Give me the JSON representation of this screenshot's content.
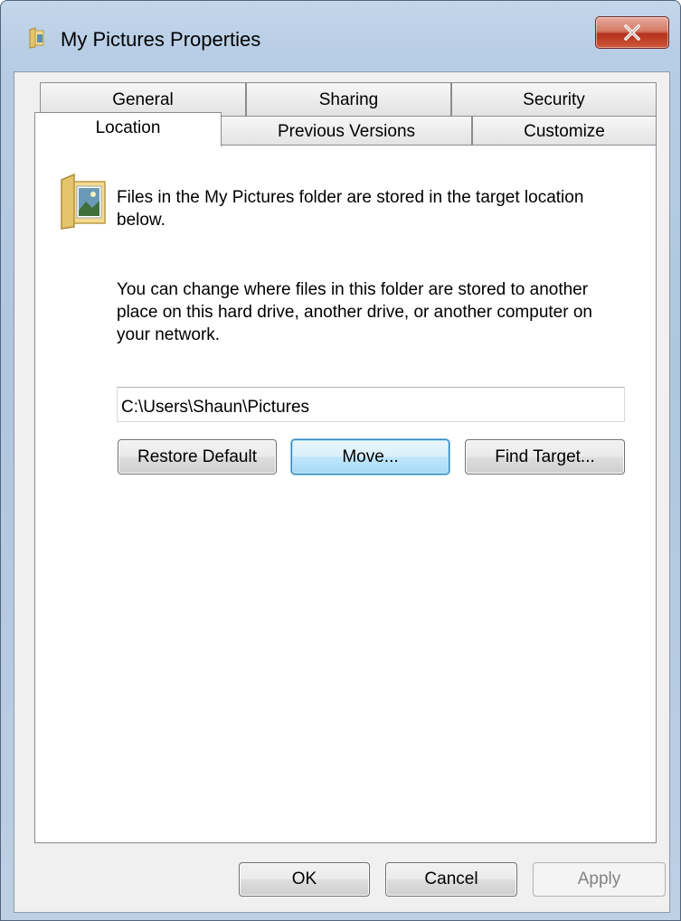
{
  "window": {
    "title": "My Pictures Properties",
    "close_label": "X"
  },
  "tabs": {
    "back_row": [
      "General",
      "Sharing",
      "Security"
    ],
    "front_row": [
      "Location",
      "Previous Versions",
      "Customize"
    ],
    "active": "Location"
  },
  "location": {
    "description": "Files in the My Pictures folder are stored in the target location below.",
    "help_text": "You can change where files in this folder are stored to another place on this hard drive, another drive, or another computer on your network.",
    "path_value": "C:\\Users\\Shaun\\Pictures",
    "restore_default_label": "Restore Default",
    "move_label": "Move...",
    "find_target_label": "Find Target..."
  },
  "footer": {
    "ok_label": "OK",
    "cancel_label": "Cancel",
    "apply_label": "Apply"
  },
  "colors": {
    "accent_default_button": "#3c7fb1",
    "close_button": "#c2432a",
    "window_frame": "#b7cde5"
  },
  "icons": {
    "title": "folder-pictures-icon",
    "close": "close-icon",
    "location": "folder-pictures-icon"
  }
}
